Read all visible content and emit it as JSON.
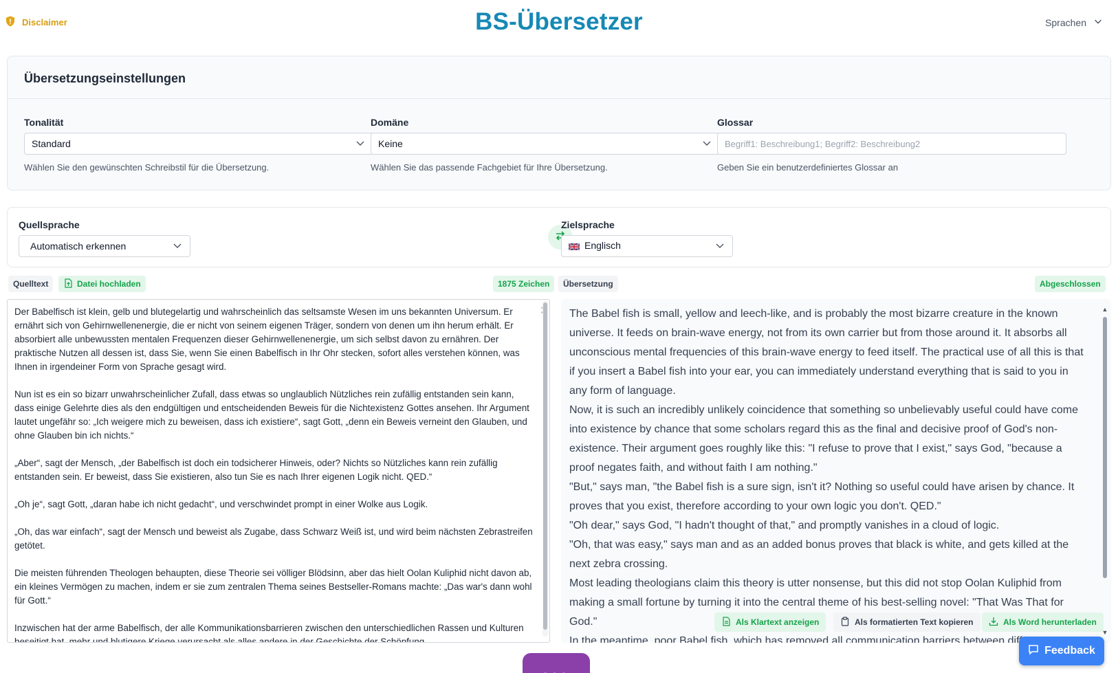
{
  "header": {
    "disclaimer_label": "Disclaimer",
    "title": "BS-Übersetzer",
    "languages_menu_label": "Sprachen"
  },
  "settings": {
    "title": "Übersetzungseinstellungen",
    "tonality": {
      "label": "Tonalität",
      "value": "Standard",
      "hint": "Wählen Sie den gewünschten Schreibstil für die Übersetzung."
    },
    "domain": {
      "label": "Domäne",
      "value": "Keine",
      "hint": "Wählen Sie das passende Fachgebiet für Ihre Übersetzung."
    },
    "glossary": {
      "label": "Glossar",
      "placeholder": "Begriff1: Beschreibung1; Begriff2: Beschreibung2",
      "hint": "Geben Sie ein benutzerdefiniertes Glossar an"
    }
  },
  "languages": {
    "source_label": "Quellsprache",
    "source_value": "Automatisch erkennen",
    "target_label": "Zielsprache",
    "target_value": "Englisch",
    "target_flag_icon": "uk-flag-icon"
  },
  "source": {
    "tab_label": "Quelltext",
    "upload_label": "Datei hochladen",
    "char_count": "1875 Zeichen",
    "text": "Der Babelfisch ist klein, gelb und blutegelartig und wahrscheinlich das seltsamste Wesen im uns bekannten Universum. Er ernährt sich von Gehirnwellenenergie, die er nicht von seinem eigenen Träger, sondern von denen um ihn herum erhält. Er absorbiert alle unbewussten mentalen Frequenzen dieser Gehirnwellenenergie, um sich selbst davon zu ernähren. Der praktische Nutzen all dessen ist, dass Sie, wenn Sie einen Babelfisch in Ihr Ohr stecken, sofort alles verstehen können, was Ihnen in irgendeiner Form von Sprache gesagt wird.\n\nNun ist es ein so bizarr unwahrscheinlicher Zufall, dass etwas so unglaublich Nützliches rein zufällig entstanden sein kann, dass einige Gelehrte dies als den endgültigen und entscheidenden Beweis für die Nichtexistenz Gottes ansehen. Ihr Argument lautet ungefähr so: „Ich weigere mich zu beweisen, dass ich existiere“, sagt Gott, „denn ein Beweis verneint den Glauben, und ohne Glauben bin ich nichts.“\n\n„Aber“, sagt der Mensch, „der Babelfisch ist doch ein todsicherer Hinweis, oder? Nichts so Nützliches kann rein zufällig entstanden sein. Er beweist, dass Sie existieren, also tun Sie es nach Ihrer eigenen Logik nicht. QED.“\n\n„Oh je“, sagt Gott, „daran habe ich nicht gedacht“, und verschwindet prompt in einer Wolke aus Logik.\n\n„Oh, das war einfach“, sagt der Mensch und beweist als Zugabe, dass Schwarz Weiß ist, und wird beim nächsten Zebrastreifen getötet.\n\nDie meisten führenden Theologen behaupten, diese Theorie sei völliger Blödsinn, aber das hielt Oolan Kuliphid nicht davon ab, ein kleines Vermögen zu machen, indem er sie zum zentralen Thema seines Bestseller-Romans machte: „Das war's dann wohl für Gott.“\n\nInzwischen hat der arme Babelfisch, der alle Kommunikationsbarrieren zwischen den unterschiedlichen Rassen und Kulturen beseitigt hat, mehr und blutigere Kriege verursacht als alles andere in der Geschichte der Schöpfung."
  },
  "target": {
    "tab_label": "Übersetzung",
    "status": "Abgeschlossen",
    "paragraphs": [
      "The Babel fish is small, yellow and leech-like, and is probably the most bizarre creature in the known universe. It feeds on brain-wave energy, not from its own carrier but from those around it. It absorbs all unconscious mental frequencies of this brain-wave energy to feed itself. The practical use of all this is that if you insert a Babel fish into your ear, you can immediately understand everything that is said to you in any form of language.",
      "Now, it is such an incredibly unlikely coincidence that something so unbelievably useful could have come into existence by chance that some scholars regard this as the final and decisive proof of God's non-existence. Their argument goes roughly like this: \"I refuse to prove that I exist,\" says God, \"because a proof negates faith, and without faith I am nothing.\"",
      "\"But,\" says man, \"the Babel fish is a sure sign, isn't it? Nothing so useful could have arisen by chance. It proves that you exist, therefore according to your own logic you don't. QED.\"",
      "\"Oh dear,\" says God, \"I hadn't thought of that,\" and promptly vanishes in a cloud of logic.",
      "\"Oh, that was easy,\" says man and as an added bonus proves that black is white, and gets killed at the next zebra crossing.",
      "Most leading theologians claim this theory is utter nonsense, but this did not stop Oolan Kuliphid from making a small fortune by turning it into the central theme of his best-selling novel: \"That Was That for God.\"",
      "In the meantime, poor Babel fish, which has removed all communication barriers between different races and cultures, has caused more and bloodier wars than anything else in the history of creation."
    ],
    "actions": {
      "plaintext_label": "Als Klartext anzeigen",
      "copy_label": "Als formatierten Text kopieren",
      "word_label": "Als Word herunterladen"
    }
  },
  "feedback_label": "Feedback",
  "colors": {
    "title": "#1689b5",
    "accent_green": "#16a34a",
    "feedback": "#3b82f6",
    "translate": "#8b3fa8"
  }
}
